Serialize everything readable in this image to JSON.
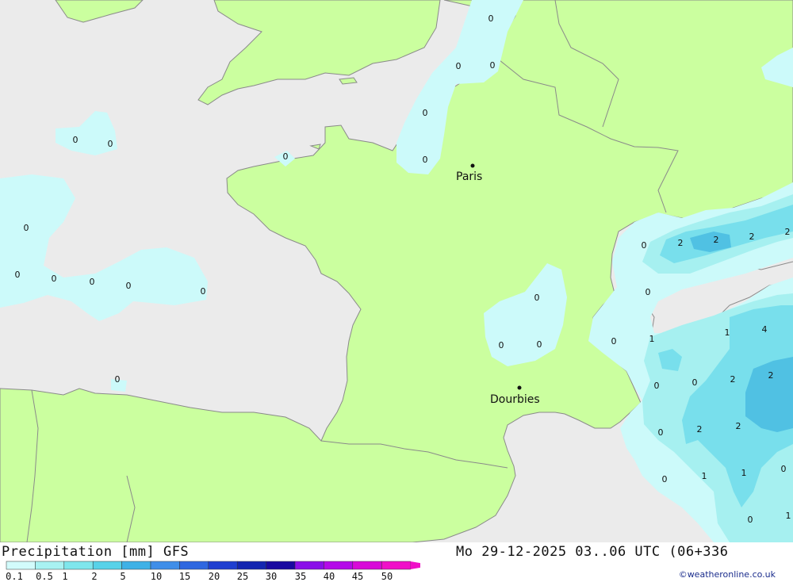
{
  "map": {
    "colors": {
      "sea": "#ebebeb",
      "land": "#cbff9f",
      "border": "#8a8a8a",
      "p1": "#ccfafa",
      "p2": "#a6f0f0",
      "p3": "#78dfec",
      "p4": "#50c1e3"
    },
    "cities": [
      {
        "name": "Paris"
      },
      {
        "name": "Dourbies"
      }
    ],
    "labels": [
      "0",
      "0",
      "0",
      "0",
      "0",
      "0",
      "0",
      "0",
      "0",
      "0",
      "0",
      "0",
      "0",
      "0",
      "0",
      "0",
      "0",
      "0",
      "0",
      "0",
      "2",
      "2",
      "2",
      "2",
      "0",
      "1",
      "1",
      "4",
      "0",
      "0",
      "2",
      "2",
      "2",
      "2",
      "0",
      "0",
      "1",
      "1",
      "0",
      "0",
      "1"
    ]
  },
  "footer": {
    "title": "Precipitation [mm] GFS",
    "datetime": "Mo 29-12-2025 03..06 UTC (06+336",
    "credit": "©weatheronline.co.uk",
    "scale_labels": [
      "0.1",
      "0.5",
      "1",
      "2",
      "5",
      "10",
      "15",
      "20",
      "25",
      "30",
      "35",
      "40",
      "45",
      "50"
    ],
    "scale_colors": [
      "#d2fbfb",
      "#a8f2f2",
      "#7fe6ec",
      "#58d2e8",
      "#3fb1e6",
      "#3f8ee8",
      "#2f67e0",
      "#1f3fd0",
      "#1426b0",
      "#1a0aa0",
      "#8a10e8",
      "#b40ae8",
      "#d80ad8",
      "#f010c8"
    ]
  }
}
